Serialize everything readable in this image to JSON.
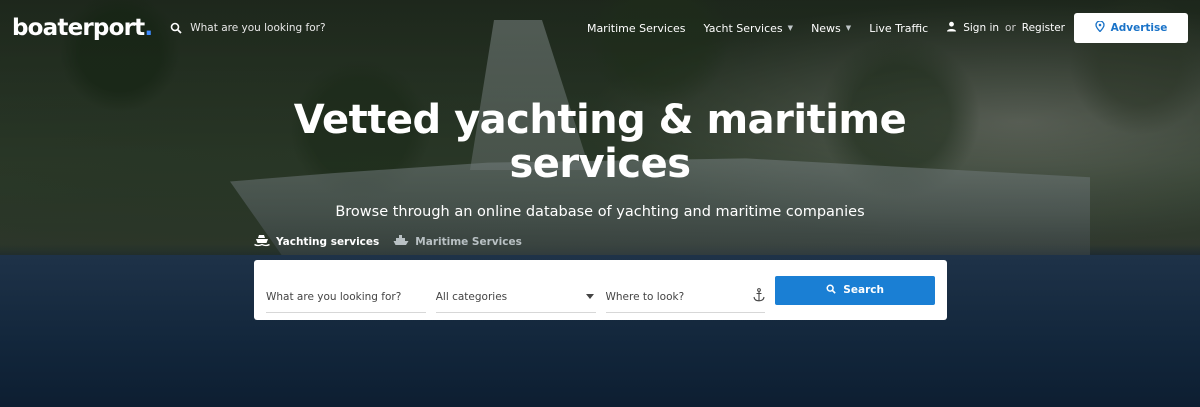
{
  "header": {
    "logo": "boaterport",
    "logo_dot": ".",
    "search_placeholder": "What are you looking for?",
    "nav": [
      {
        "label": "Maritime Services",
        "dropdown": false
      },
      {
        "label": "Yacht Services",
        "dropdown": true
      },
      {
        "label": "News",
        "dropdown": true
      },
      {
        "label": "Live Traffic",
        "dropdown": false
      }
    ],
    "signin": "Sign in",
    "or": "or",
    "register": "Register",
    "advertise": "Advertise"
  },
  "hero": {
    "headline_line1": "Vetted yachting & maritime",
    "headline_line2": "services",
    "subheadline": "Browse through an online database of yachting and maritime companies"
  },
  "tabs": [
    {
      "label": "Yachting services",
      "active": true,
      "icon": "yacht-icon"
    },
    {
      "label": "Maritime Services",
      "active": false,
      "icon": "ship-icon"
    }
  ],
  "search_form": {
    "what_placeholder": "What are you looking for?",
    "category_selected": "All categories",
    "where_placeholder": "Where to look?",
    "button_label": "Search"
  },
  "colors": {
    "accent": "#1a7fd4",
    "logo_dot": "#3d8bff",
    "advertise_text": "#1a73c8"
  }
}
